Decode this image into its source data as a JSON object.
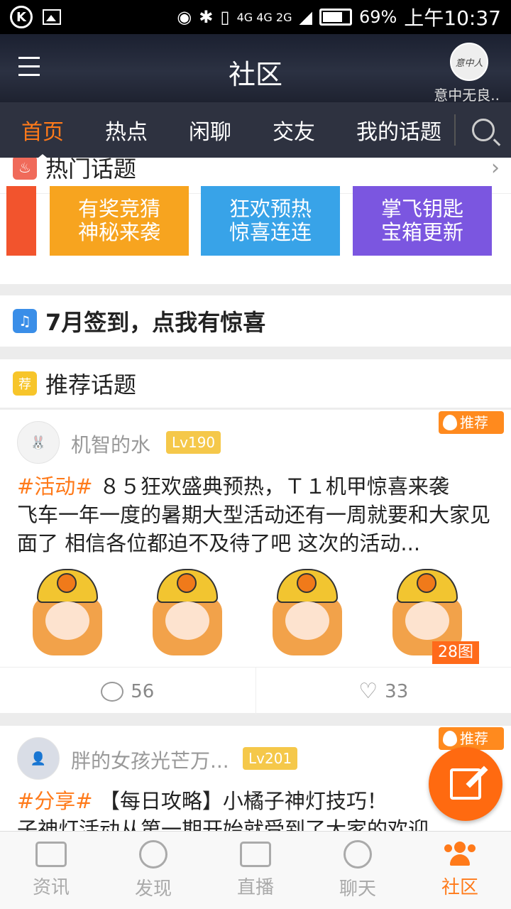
{
  "status_bar": {
    "battery": "69%",
    "time": "上午10:37",
    "network": "4G 4G 2G"
  },
  "header": {
    "title": "社区",
    "user_name": "意中无良..",
    "avatar_text": "意中人"
  },
  "tabs": [
    "首页",
    "热点",
    "闲聊",
    "交友",
    "我的话题"
  ],
  "hot": {
    "title": "热门话题",
    "banners": [
      {
        "line1": "有奖竞猜",
        "line2": "神秘来袭",
        "color": "#f7a41f"
      },
      {
        "line1": "狂欢预热",
        "line2": "惊喜连连",
        "color": "#38a3e8"
      },
      {
        "line1": "掌飞钥匙",
        "line2": "宝箱更新",
        "color": "#7b56e0"
      }
    ]
  },
  "checkin": {
    "title": "7月签到，点我有惊喜"
  },
  "recommend": {
    "title": "推荐话题",
    "icon_text": "荐"
  },
  "posts": [
    {
      "user": "机智的水",
      "level": "Lv190",
      "badge": "推荐",
      "tag": "#活动#",
      "headline": " ８５狂欢盛典预热，Ｔ１机甲惊喜来袭",
      "body": "飞车一年一度的暑期大型活动还有一周就要和大家见面了 相信各位都迫不及待了吧 这次的活动...",
      "image_count": "28图",
      "comments": "56",
      "likes": "33"
    },
    {
      "user": "胖的女孩光芒万...",
      "level": "Lv201",
      "badge": "推荐",
      "tag": "#分享#",
      "headline": " 【每日攻略】小橘子神灯技巧！",
      "body": "子神灯活动从第一期开始就受到了大家的欢迎"
    }
  ],
  "bottom_nav": [
    "资讯",
    "发现",
    "直播",
    "聊天",
    "社区"
  ],
  "colors": {
    "accent": "#ff7a1a",
    "tabbar": "#2e3240"
  }
}
